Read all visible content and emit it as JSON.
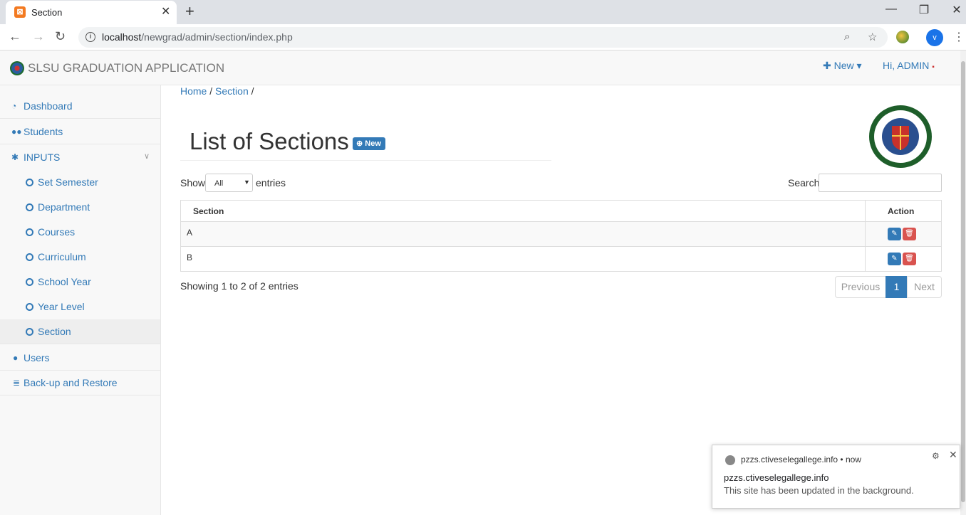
{
  "browser": {
    "tab_title": "Section",
    "url_host": "localhost",
    "url_path": "/newgrad/admin/section/index.php",
    "profile_initial": "v"
  },
  "navbar": {
    "brand": "SLSU GRADUATION APPLICATION",
    "new_label": "New",
    "greeting": "Hi, ADMIN"
  },
  "sidebar": {
    "items": [
      {
        "label": "Dashboard",
        "icon": "dashboard-icon"
      },
      {
        "label": "Students",
        "icon": "users-icon"
      },
      {
        "label": "INPUTS",
        "icon": "gear-icon"
      }
    ],
    "sub_items": [
      {
        "label": "Set Semester"
      },
      {
        "label": "Department"
      },
      {
        "label": "Courses"
      },
      {
        "label": "Curriculum"
      },
      {
        "label": "School Year"
      },
      {
        "label": "Year Level"
      },
      {
        "label": "Section",
        "active": true
      }
    ],
    "bottom_items": [
      {
        "label": "Users",
        "icon": "user-icon"
      },
      {
        "label": "Back-up and Restore",
        "icon": "database-icon"
      }
    ]
  },
  "breadcrumb": {
    "home": "Home",
    "section": "Section"
  },
  "page": {
    "title": "List of Sections",
    "new_button": "New"
  },
  "datatable": {
    "show_label": "Show",
    "length_value": "All",
    "entries_label": "entries",
    "search_label": "Search:",
    "search_value": "",
    "columns": [
      "Section",
      "Action"
    ],
    "rows": [
      {
        "section": "A"
      },
      {
        "section": "B"
      }
    ],
    "info": "Showing 1 to 2 of 2 entries",
    "pagination": {
      "previous": "Previous",
      "current": "1",
      "next": "Next"
    }
  },
  "notification": {
    "source": "pzzs.ctiveselegallege.info",
    "time": "now",
    "title": "pzzs.ctiveselegallege.info",
    "body": "This site has been updated in the background."
  },
  "colors": {
    "link": "#337ab7",
    "danger": "#d9534f"
  }
}
